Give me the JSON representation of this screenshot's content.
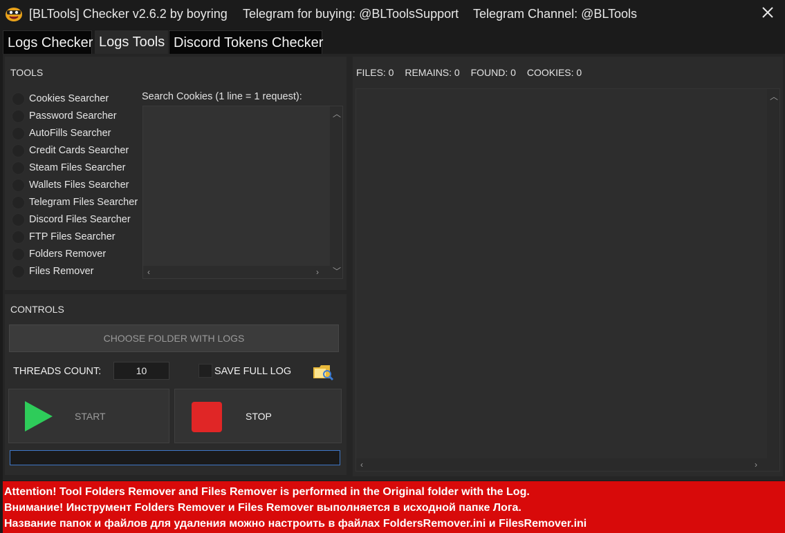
{
  "titlebar": {
    "title": "[BLTools] Checker v2.6.2 by boyring",
    "telegram_buying": "Telegram for buying: @BLToolsSupport",
    "telegram_channel": "Telegram Channel: @BLTools"
  },
  "tabs": [
    {
      "label": "Logs Checker"
    },
    {
      "label": "Logs Tools"
    },
    {
      "label": "Discord Tokens Checker"
    }
  ],
  "tools": {
    "header": "TOOLS",
    "items": [
      {
        "label": "Cookies Searcher"
      },
      {
        "label": "Password Searcher"
      },
      {
        "label": "AutoFills Searcher"
      },
      {
        "label": "Credit Cards Searcher"
      },
      {
        "label": "Steam Files Searcher"
      },
      {
        "label": "Wallets Files Searcher"
      },
      {
        "label": "Telegram Files Searcher"
      },
      {
        "label": "Discord Files Searcher"
      },
      {
        "label": "FTP Files Searcher"
      },
      {
        "label": "Folders Remover"
      },
      {
        "label": "Files Remover"
      }
    ],
    "search_label": "Search Cookies (1 line = 1 request):"
  },
  "controls": {
    "header": "CONTROLS",
    "choose_folder": "CHOOSE FOLDER WITH LOGS",
    "threads_label": "THREADS COUNT:",
    "threads_value": "10",
    "save_full_log": "SAVE FULL LOG",
    "start": "START",
    "stop": "STOP"
  },
  "stats": {
    "files": "FILES: 0",
    "remains": "REMAINS: 0",
    "found": "FOUND: 0",
    "cookies": "COOKIES: 0"
  },
  "alert": {
    "line1": "Attention! Tool Folders Remover and Files Remover is performed in the Original folder with the Log.",
    "line2": "Внимание! Инструмент Folders Remover и Files Remover выполняется в исходной папке Лога.",
    "line3": "Название папок и файлов для удаления можно настроить в файлах FoldersRemover.ini и FilesRemover.ini"
  },
  "colors": {
    "alert_bg": "#d80a0a",
    "start_green": "#2ecc5a",
    "stop_red": "#e02626",
    "progress_border": "#3f78c8"
  }
}
